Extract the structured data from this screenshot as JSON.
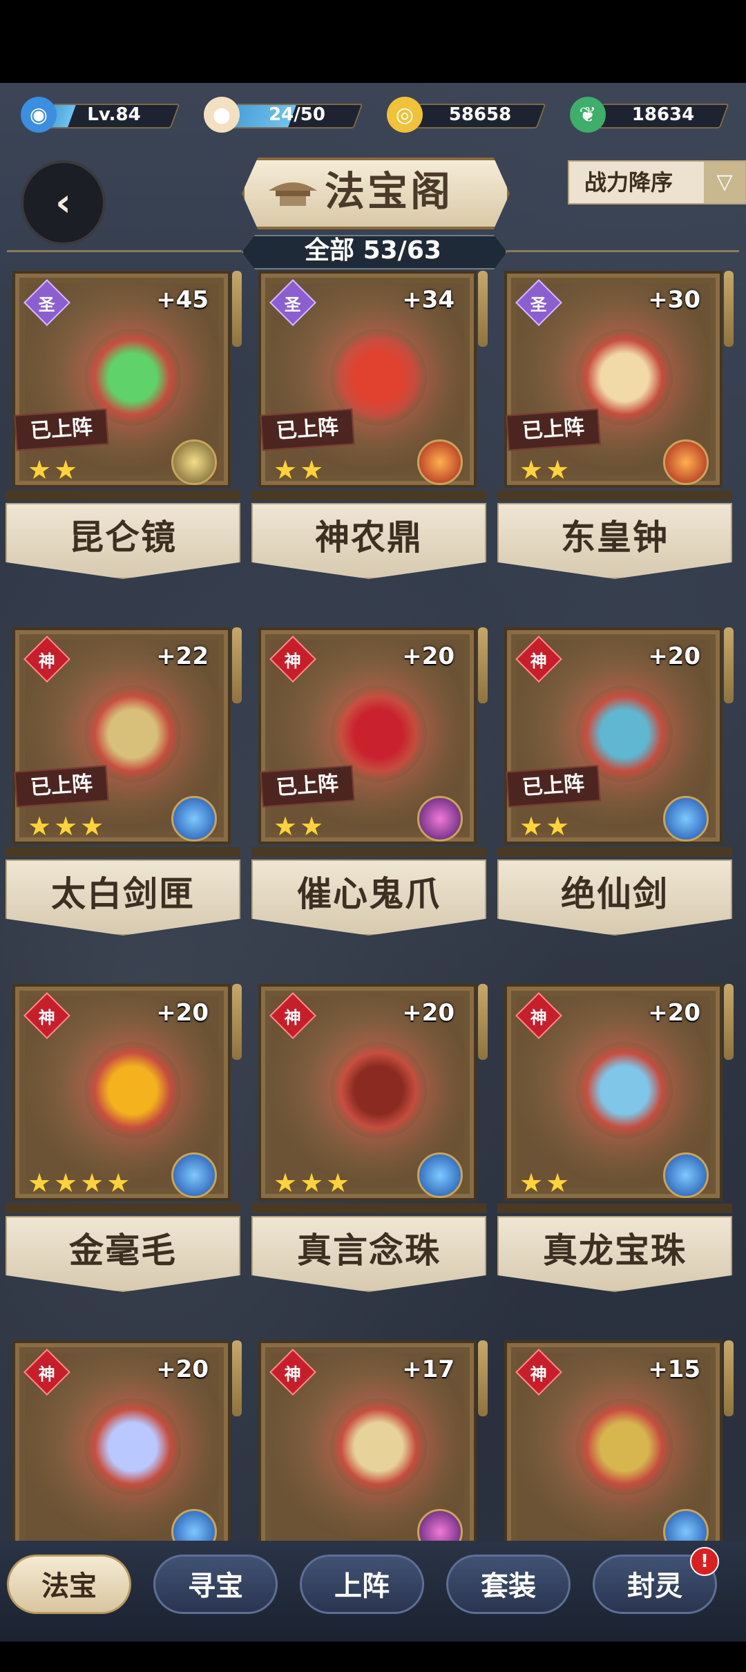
{
  "resources": [
    {
      "icon": "spirit-flame-icon",
      "text": "Lv.84",
      "fill_percent": 18
    },
    {
      "icon": "bun-icon",
      "text": "24/50",
      "fill_percent": 48
    },
    {
      "icon": "gold-coin-icon",
      "text": "58658",
      "fill_percent": 0
    },
    {
      "icon": "jade-leaf-icon",
      "text": "18634",
      "fill_percent": 0
    }
  ],
  "header": {
    "title": "法宝阁",
    "sort_label": "战力降序",
    "count_text": "全部 53/63"
  },
  "deployed_label": "已上阵",
  "tiers": {
    "sheng": "圣",
    "shen": "神"
  },
  "cards": [
    {
      "name": "昆仑镜",
      "tier": "sheng",
      "plus": "+45",
      "stars": 2,
      "deployed": true,
      "element": "gold-element-icon",
      "color": "#5fd36a"
    },
    {
      "name": "神农鼎",
      "tier": "sheng",
      "plus": "+34",
      "stars": 2,
      "deployed": true,
      "element": "fire-element-icon",
      "color": "#e0422f"
    },
    {
      "name": "东皇钟",
      "tier": "sheng",
      "plus": "+30",
      "stars": 2,
      "deployed": true,
      "element": "flame-element-icon",
      "color": "#f1d9a8"
    },
    {
      "name": "太白剑匣",
      "tier": "shen",
      "plus": "+22",
      "stars": 3,
      "deployed": true,
      "element": "water-element-icon",
      "color": "#d8c07a"
    },
    {
      "name": "催心鬼爪",
      "tier": "shen",
      "plus": "+20",
      "stars": 2,
      "deployed": true,
      "element": "shadow-element-icon",
      "color": "#c9222e"
    },
    {
      "name": "绝仙剑",
      "tier": "shen",
      "plus": "+20",
      "stars": 2,
      "deployed": true,
      "element": "wind-element-icon",
      "color": "#5fb7d1"
    },
    {
      "name": "金毫毛",
      "tier": "shen",
      "plus": "+20",
      "stars": 4,
      "deployed": false,
      "element": "water-element-icon",
      "color": "#f3b21e"
    },
    {
      "name": "真言念珠",
      "tier": "shen",
      "plus": "+20",
      "stars": 3,
      "deployed": false,
      "element": "water-element-icon",
      "color": "#8a2a20"
    },
    {
      "name": "真龙宝珠",
      "tier": "shen",
      "plus": "+20",
      "stars": 2,
      "deployed": false,
      "element": "water-element-icon",
      "color": "#7fc6e8"
    },
    {
      "name": "",
      "tier": "shen",
      "plus": "+20",
      "stars": 0,
      "deployed": false,
      "element": "water-element-icon",
      "color": "#b9c8ff"
    },
    {
      "name": "",
      "tier": "shen",
      "plus": "+17",
      "stars": 0,
      "deployed": false,
      "element": "shadow-element-icon",
      "color": "#e7d39a"
    },
    {
      "name": "",
      "tier": "shen",
      "plus": "+15",
      "stars": 0,
      "deployed": false,
      "element": "water-element-icon",
      "color": "#d7b650"
    }
  ],
  "tabs": [
    {
      "label": "法宝",
      "active": true,
      "badge": ""
    },
    {
      "label": "寻宝",
      "active": false,
      "badge": ""
    },
    {
      "label": "上阵",
      "active": false,
      "badge": ""
    },
    {
      "label": "套装",
      "active": false,
      "badge": ""
    },
    {
      "label": "封灵",
      "active": false,
      "badge": "!"
    }
  ]
}
